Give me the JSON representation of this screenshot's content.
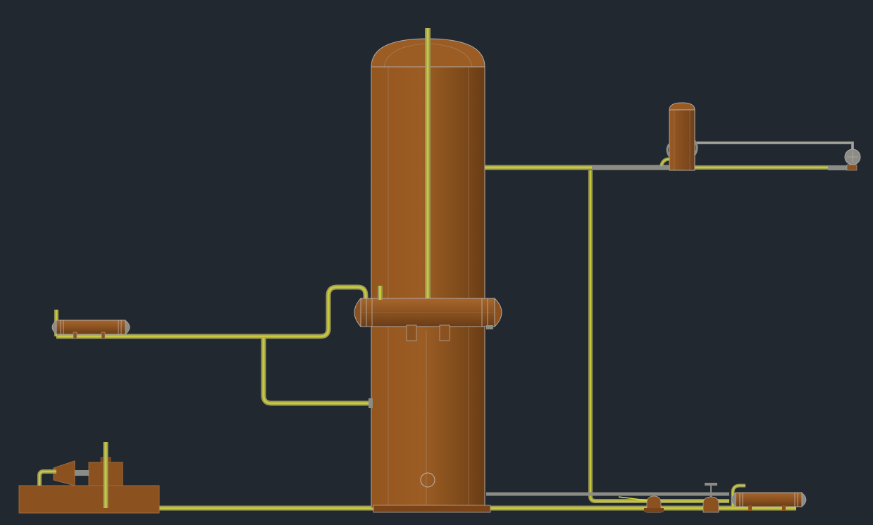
{
  "canvas": {
    "background": "#212830"
  },
  "palette": {
    "vessel_fill": "#8b5220",
    "vessel_light": "#a8662c",
    "vessel_dark": "#6a3c16",
    "vessel_edge": "#b0a8a0",
    "pipe_outer": "#9a9a58",
    "pipe_inner": "#c8c83a",
    "pipe_gray": "#8c8c86",
    "detail_gray": "#9a9890"
  },
  "equipment": [
    {
      "id": "main-column",
      "kind": "vertical vessel with dome head"
    },
    {
      "id": "side-heat-exchanger",
      "kind": "horizontal shell and tube exchanger on column"
    },
    {
      "id": "left-heat-exchanger",
      "kind": "horizontal shell and tube exchanger"
    },
    {
      "id": "reflux-drum",
      "kind": "small vertical vessel"
    },
    {
      "id": "right-end-cap",
      "kind": "nozzle cap"
    },
    {
      "id": "bottom-right-exchanger",
      "kind": "horizontal shell and tube exchanger"
    },
    {
      "id": "pump-skid",
      "kind": "pump and motor on base"
    },
    {
      "id": "pump-small",
      "kind": "small pump"
    },
    {
      "id": "control-valve",
      "kind": "valve with handwheel"
    }
  ]
}
